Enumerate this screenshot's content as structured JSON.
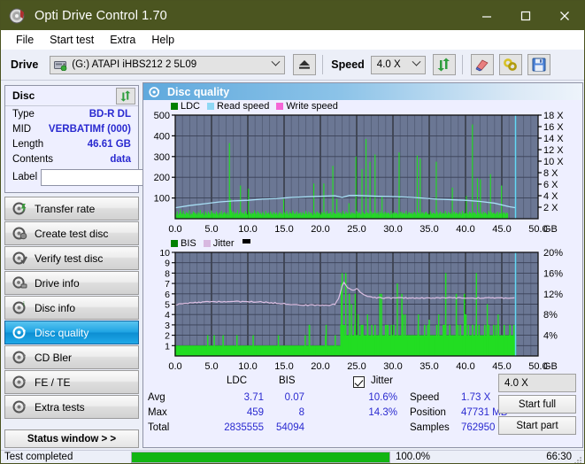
{
  "window": {
    "title": "Opti Drive Control 1.70",
    "icon": "disc-icon",
    "minimize": "─",
    "maximize": "☐",
    "close": "✕"
  },
  "menu": {
    "items": [
      {
        "label": "File",
        "name": "menu-file"
      },
      {
        "label": "Start test",
        "name": "menu-start-test"
      },
      {
        "label": "Extra",
        "name": "menu-extra"
      },
      {
        "label": "Help",
        "name": "menu-help"
      }
    ]
  },
  "toolbar": {
    "drive_label": "Drive",
    "drive_value": "(G:)  ATAPI iHBS212  2 5L09",
    "eject_icon": "eject-icon",
    "speed_label": "Speed",
    "speed_value": "4.0 X",
    "refresh_icon": "refresh-icon",
    "erase_icon": "eraser-icon",
    "tools_icon": "tools-icon",
    "save_icon": "save-icon"
  },
  "disc": {
    "title": "Disc",
    "refresh_icon": "refresh-icon",
    "rows": [
      {
        "key": "Type",
        "value": "BD-R DL"
      },
      {
        "key": "MID",
        "value": "VERBATIMf (000)"
      },
      {
        "key": "Length",
        "value": "46.61 GB"
      },
      {
        "key": "Contents",
        "value": "data"
      }
    ],
    "label_key": "Label",
    "label_value": "",
    "label_placeholder": "",
    "label_button_icon": "disc-icon"
  },
  "sidebar": {
    "items": [
      {
        "label": "Transfer rate",
        "name": "sidebar-item-transfer-rate",
        "icon": "disc-test-icon",
        "active": false
      },
      {
        "label": "Create test disc",
        "name": "sidebar-item-create-test-disc",
        "icon": "disc-test-icon",
        "active": false
      },
      {
        "label": "Verify test disc",
        "name": "sidebar-item-verify-test-disc",
        "icon": "disc-test-icon",
        "active": false
      },
      {
        "label": "Drive info",
        "name": "sidebar-item-drive-info",
        "icon": "disc-test-icon",
        "active": false
      },
      {
        "label": "Disc info",
        "name": "sidebar-item-disc-info",
        "icon": "disc-test-icon",
        "active": false
      },
      {
        "label": "Disc quality",
        "name": "sidebar-item-disc-quality",
        "icon": "disc-test-icon",
        "active": true
      },
      {
        "label": "CD Bler",
        "name": "sidebar-item-cd-bler",
        "icon": "disc-test-icon",
        "active": false
      },
      {
        "label": "FE / TE",
        "name": "sidebar-item-fe-te",
        "icon": "disc-test-icon",
        "active": false
      },
      {
        "label": "Extra tests",
        "name": "sidebar-item-extra-tests",
        "icon": "disc-test-icon",
        "active": false
      }
    ],
    "status_window_button": "Status window > >"
  },
  "panel": {
    "title": "Disc quality",
    "icon": "disc-quality-icon"
  },
  "stats": {
    "col_ldc": "LDC",
    "col_bis": "BIS",
    "row_avg": "Avg",
    "row_max": "Max",
    "row_total": "Total",
    "ldc_avg": "3.71",
    "ldc_max": "459",
    "ldc_total": "2835555",
    "bis_avg": "0.07",
    "bis_max": "8",
    "bis_total": "54094",
    "jitter_label": "Jitter",
    "jitter_checked": true,
    "jitter_avg": "10.6%",
    "jitter_max": "14.3%",
    "speed_label": "Speed",
    "speed_value": "1.73 X",
    "position_label": "Position",
    "position_value": "47731 MB",
    "samples_label": "Samples",
    "samples_value": "762950",
    "speed_select": "4.0 X",
    "start_full": "Start full",
    "start_part": "Start part"
  },
  "statusbar": {
    "text": "Test completed",
    "percent": "100.0%",
    "progress": 100,
    "elapsed": "66:30",
    "progress_color": "#12b512"
  },
  "colors": {
    "title_bar": "#4b5520",
    "panel_bg": "#eeefff",
    "plot_bg": "#6b7794",
    "ldc": "#22dd22",
    "bis": "#22dd22",
    "read_speed": "#8fd8f5",
    "write_speed": "#f566d6",
    "jitter": "#d8b8e0",
    "accent_blue": "#2a2ad0",
    "active_tab": "#1fa4e4"
  },
  "chart_data": [
    {
      "type": "line",
      "name": "ldc-chart",
      "title": "",
      "xlabel": "GB",
      "ylabel": "",
      "xlim": [
        0,
        50
      ],
      "ylim": [
        0,
        500
      ],
      "y2lim": [
        0,
        18
      ],
      "y2label": "X",
      "grid": true,
      "legend_position": "top-left",
      "legend": [
        {
          "label": "LDC",
          "color": "#008000"
        },
        {
          "label": "Read speed",
          "color": "#8fd8f5"
        },
        {
          "label": "Write speed",
          "color": "#f566d6"
        }
      ],
      "yticks": [
        100,
        200,
        300,
        400,
        500
      ],
      "y2ticks": [
        "2 X",
        "4 X",
        "6 X",
        "8 X",
        "10 X",
        "12 X",
        "14 X",
        "16 X",
        "18 X"
      ],
      "xticks": [
        "0.0",
        "5.0",
        "10.0",
        "15.0",
        "20.0",
        "25.0",
        "30.0",
        "35.0",
        "40.0",
        "45.0",
        "50.0"
      ],
      "xunit": "GB",
      "data_end_gb": 46.9,
      "series": [
        {
          "name": "LDC",
          "color": "#22dd22",
          "type": "spikes",
          "baseline": 20,
          "values": [
            28,
            22,
            35,
            18,
            26,
            45,
            30,
            22,
            38,
            25,
            20,
            32,
            28,
            24,
            40,
            18,
            26,
            22,
            35,
            30,
            24,
            28,
            20,
            32,
            26,
            42,
            22,
            30,
            25,
            18,
            36,
            28,
            20,
            34,
            26,
            22,
            40,
            30,
            24,
            28,
            22,
            35,
            26,
            18,
            30,
            24,
            38,
            20,
            28,
            32,
            26,
            22,
            30,
            18,
            365,
            95,
            40,
            28,
            35,
            22,
            30,
            26,
            42,
            20,
            28,
            160,
            32,
            24,
            30,
            22,
            38,
            28,
            20,
            145,
            34,
            26,
            22,
            30,
            25,
            40,
            28,
            22,
            36,
            30,
            24,
            28,
            20,
            32,
            26,
            18,
            38,
            28,
            24,
            30,
            22,
            35,
            26,
            20,
            32,
            28,
            22,
            30,
            18,
            26,
            34,
            24,
            28,
            20,
            95,
            30,
            22,
            38,
            26,
            18,
            32,
            28,
            24,
            40,
            30,
            22,
            26,
            35,
            20,
            28,
            24,
            30,
            18,
            32,
            26,
            22,
            38,
            28,
            20,
            34,
            24,
            30,
            26,
            18,
            170,
            28,
            22,
            36,
            30,
            24,
            28,
            20,
            32,
            26,
            170,
            30,
            22,
            38,
            26,
            24,
            28,
            34,
            20,
            255,
            30,
            26,
            22,
            95,
            28,
            32,
            24,
            30,
            20,
            38,
            26,
            22,
            34,
            28,
            24,
            75,
            30,
            20,
            32,
            26,
            28,
            22,
            300,
            36,
            24,
            30,
            28,
            20,
            240,
            32,
            26,
            22,
            385,
            30,
            28,
            24,
            275,
            36,
            22,
            30,
            26,
            310,
            28,
            24,
            32,
            20,
            38,
            26,
            110,
            30,
            22,
            34,
            28,
            24,
            30,
            26,
            20,
            38,
            22,
            28,
            32,
            24,
            30,
            26,
            20,
            320,
            28,
            34,
            22,
            30,
            24,
            26,
            38,
            20,
            28,
            32,
            24,
            30,
            22,
            26,
            34,
            28,
            20,
            305,
            30,
            26,
            290,
            24,
            32,
            28,
            22,
            30,
            34,
            24,
            26,
            20,
            38,
            28,
            22,
            30,
            26,
            24,
            275,
            32,
            20,
            28,
            34,
            22,
            30,
            26,
            24,
            38,
            28,
            20,
            32,
            26,
            30,
            22,
            150,
            28,
            34,
            24,
            30,
            26,
            22,
            32,
            28,
            20,
            38,
            24,
            30,
            26,
            110,
            28,
            22,
            34,
            30,
            24,
            455,
            28,
            32,
            26,
            20,
            195,
            30,
            24,
            190,
            28,
            22,
            34,
            26,
            30,
            24,
            20,
            38,
            28,
            215,
            32,
            24,
            30,
            26,
            22,
            28,
            34,
            20,
            30,
            26,
            160,
            24,
            32,
            28,
            22,
            30,
            26,
            0,
            0,
            0,
            0,
            0,
            0,
            0,
            0
          ]
        },
        {
          "name": "Read speed",
          "color": "#8fd8f5",
          "type": "line",
          "axis": "right",
          "values_x_gb": [
            0,
            2,
            4,
            6,
            8,
            10,
            12,
            14,
            16,
            18,
            20,
            22,
            23,
            24,
            25,
            26,
            28,
            30,
            32,
            34,
            36,
            38,
            40,
            42,
            44,
            46,
            46.9
          ],
          "values_x_speed": [
            1.9,
            2.3,
            2.6,
            2.9,
            3.1,
            3.2,
            3.4,
            3.5,
            3.7,
            3.8,
            3.9,
            4.0,
            3.7,
            4.05,
            4.05,
            4.0,
            3.9,
            3.85,
            3.75,
            3.6,
            3.4,
            3.3,
            3.2,
            3.0,
            2.7,
            2.1,
            1.9
          ]
        }
      ],
      "cursor_line_gb": 46.9,
      "cursor_color": "#64d8f5"
    },
    {
      "type": "line",
      "name": "bis-jitter-chart",
      "title": "",
      "xlabel": "GB",
      "xlim": [
        0,
        50
      ],
      "ylim": [
        0,
        10
      ],
      "y2lim": [
        0,
        20
      ],
      "y2label": "%",
      "grid": true,
      "legend_position": "top-left",
      "legend": [
        {
          "label": "BIS",
          "color": "#008000"
        },
        {
          "label": "Jitter",
          "color": "#d8b8e0"
        }
      ],
      "yticks": [
        1,
        2,
        3,
        4,
        5,
        6,
        7,
        8,
        9,
        10
      ],
      "y2ticks": [
        "4%",
        "8%",
        "12%",
        "16%",
        "20%"
      ],
      "xticks": [
        "0.0",
        "5.0",
        "10.0",
        "15.0",
        "20.0",
        "25.0",
        "30.0",
        "35.0",
        "40.0",
        "45.0",
        "50.0"
      ],
      "xunit": "GB",
      "data_end_gb": 46.9,
      "series": [
        {
          "name": "BIS",
          "color": "#22dd22",
          "type": "spikes",
          "baseline_pre": 1.0,
          "baseline_post": 2.0,
          "transition_gb": 22.8,
          "max": 8
        },
        {
          "name": "Jitter",
          "color": "#d8b8e0",
          "type": "line",
          "axis": "right",
          "values_x_gb": [
            0,
            2,
            4,
            6,
            8,
            10,
            12,
            14,
            16,
            18,
            20,
            21,
            22,
            22.5,
            23,
            23.3,
            23.6,
            24,
            24.5,
            25,
            25.3,
            26,
            27,
            28,
            30,
            32,
            34,
            36,
            38,
            40,
            42,
            44,
            46,
            46.9
          ],
          "values_y_pct": [
            9.9,
            10.2,
            10.4,
            10.5,
            10.5,
            10.5,
            10.4,
            10.2,
            10.0,
            9.8,
            9.8,
            9.8,
            10.0,
            11.0,
            13.6,
            14.3,
            13.4,
            13.0,
            12.6,
            13.0,
            12.6,
            11.8,
            11.4,
            11.2,
            11.2,
            11.2,
            11.2,
            11.2,
            11.2,
            11.2,
            11.2,
            11.2,
            11.2,
            11.2
          ]
        }
      ],
      "cursor_line_gb": 46.9,
      "cursor_color": "#64d8f5"
    }
  ]
}
